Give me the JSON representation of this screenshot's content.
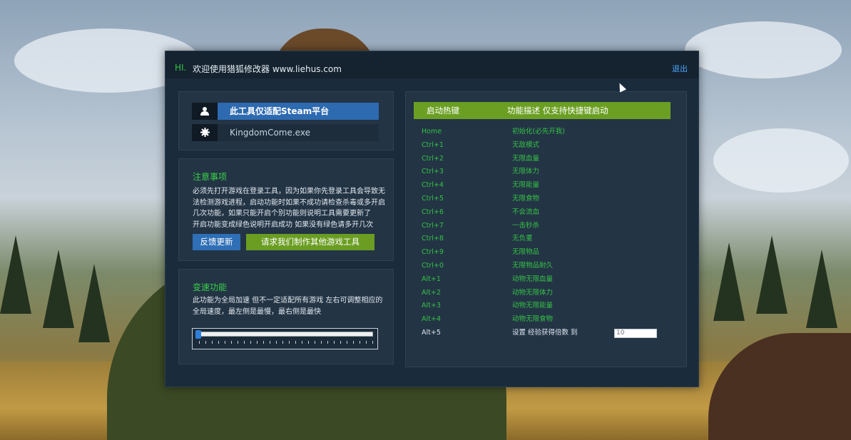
{
  "header": {
    "hi": "HI.",
    "title": "欢迎使用猎狐修改器 www.liehus.com",
    "exit_label": "退出"
  },
  "platform": {
    "steam_label": "此工具仅适配Steam平台",
    "exe_label": "KingdomCome.exe"
  },
  "notice": {
    "title": "注意事项",
    "lines": [
      "必须先打开游戏在登录工具，因为如果你先登录工具会导致无",
      "法检测游戏进程，启动功能时如果不成功请检查杀毒或多开启",
      "几次功能，如果只能开启个别功能则说明工具需要更新了",
      "开启功能变成绿色说明开启成功 如果没有绿色请多开几次"
    ],
    "feedback_button": "反馈更新",
    "request_button": "请求我们制作其他游戏工具"
  },
  "speed": {
    "title": "变速功能",
    "lines": [
      "此功能为全局加速 但不一定适配所有游戏 左右可调整相应的",
      "全局速度，最左侧是最慢，最右侧是最快"
    ],
    "slider_value": 0
  },
  "hotkeys": {
    "header_key": "启动热键",
    "header_desc": "功能描述 仅支持快捷键启动",
    "rows": [
      {
        "key": "Home",
        "desc": "初始化(必先开我)"
      },
      {
        "key": "Ctrl+1",
        "desc": "无敌模式"
      },
      {
        "key": "Ctrl+2",
        "desc": "无限血量"
      },
      {
        "key": "Ctrl+3",
        "desc": "无限体力"
      },
      {
        "key": "Ctrl+4",
        "desc": "无限能量"
      },
      {
        "key": "Ctrl+5",
        "desc": "无限食物"
      },
      {
        "key": "Ctrl+6",
        "desc": "不会流血"
      },
      {
        "key": "Ctrl+7",
        "desc": "一击秒杀"
      },
      {
        "key": "Ctrl+8",
        "desc": "无负重"
      },
      {
        "key": "Ctrl+9",
        "desc": "无限物品"
      },
      {
        "key": "Ctrl+0",
        "desc": "无限物品耐久"
      },
      {
        "key": "Alt+1",
        "desc": "动物无限血量"
      },
      {
        "key": "Alt+2",
        "desc": "动物无限体力"
      },
      {
        "key": "Alt+3",
        "desc": "动物无限能量"
      },
      {
        "key": "Alt+4",
        "desc": "动物无限食物"
      },
      {
        "key": "Alt+5",
        "desc": "设置 经验获得倍数 到"
      }
    ],
    "exp_multiplier_value": "10"
  },
  "colors": {
    "accent_green": "#6b9f23",
    "active_text_green": "#35c244",
    "steam_blue": "#2d6ab0",
    "window_bg": "#1a2b3c"
  },
  "icons": {
    "user": "user-icon",
    "gear": "gear-icon"
  }
}
